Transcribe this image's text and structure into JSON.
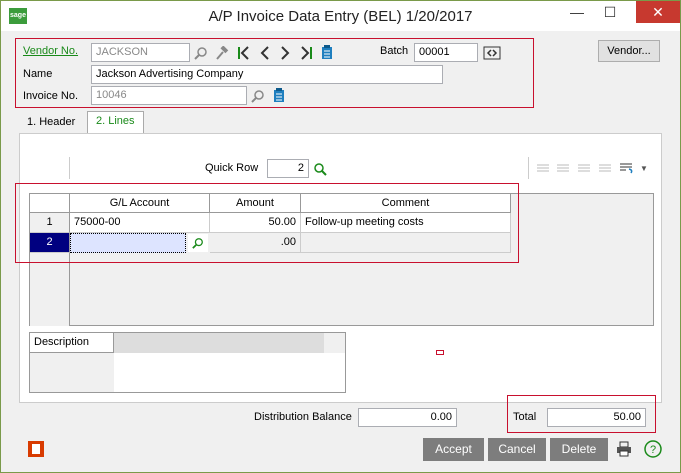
{
  "window": {
    "title": "A/P Invoice Data Entry (BEL) 1/20/2017",
    "app_icon_text": "sage",
    "minimize": "—",
    "maximize": "☐",
    "close": "✕"
  },
  "header": {
    "vendor_no_label": "Vendor No.",
    "vendor_no_value": "JACKSON",
    "batch_label": "Batch",
    "batch_value": "00001",
    "name_label": "Name",
    "name_value": "Jackson Advertising Company",
    "invoice_no_label": "Invoice No.",
    "invoice_no_value": "10046",
    "vendor_button": "Vendor..."
  },
  "tabs": [
    {
      "label": "1. Header",
      "active": false
    },
    {
      "label": "2. Lines",
      "active": true
    }
  ],
  "lines": {
    "quick_row_label": "Quick Row",
    "quick_row_value": "2",
    "columns": [
      "G/L Account",
      "Amount",
      "Comment"
    ],
    "rows": [
      {
        "num": "1",
        "account": "75000-00",
        "amount": "50.00",
        "comment": "Follow-up meeting costs"
      },
      {
        "num": "2",
        "account": "",
        "amount": ".00",
        "comment": ""
      }
    ],
    "description_label": "Description"
  },
  "totals": {
    "distribution_balance_label": "Distribution Balance",
    "distribution_balance_value": "0.00",
    "total_label": "Total",
    "total_value": "50.00"
  },
  "footer": {
    "accept": "Accept",
    "cancel": "Cancel",
    "delete": "Delete"
  },
  "colors": {
    "accent_green": "#1a8a1a",
    "highlight_red": "#c8102e",
    "selected_row": "#000080"
  }
}
